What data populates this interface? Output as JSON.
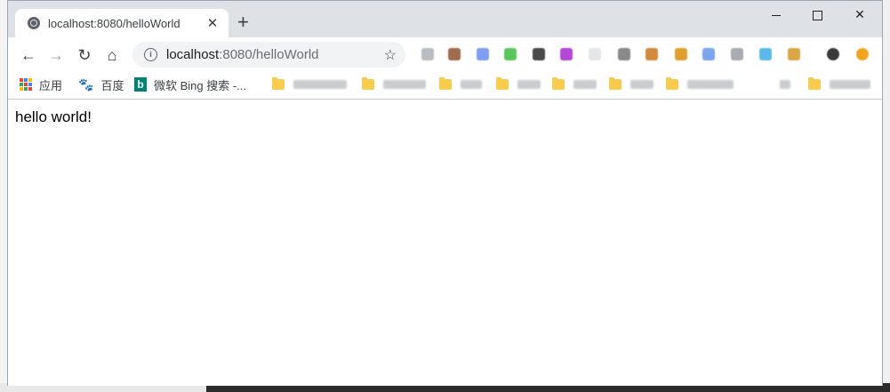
{
  "browser": {
    "tab": {
      "title": "localhost:8080/helloWorld",
      "close_glyph": "✕"
    },
    "new_tab_glyph": "+",
    "window_controls": {
      "close_glyph": "✕"
    },
    "toolbar": {
      "back_glyph": "←",
      "forward_glyph": "→",
      "reload_glyph": "↻",
      "home_glyph": "⌂",
      "star_glyph": "☆",
      "url_host": "localhost",
      "url_rest": ":8080/helloWorld"
    },
    "bookmarks": [
      {
        "label": "应用",
        "icon": "apps-grid-icon"
      },
      {
        "label": "百度",
        "icon": "baidu-paw-icon"
      },
      {
        "label": "微软 Bing 搜索 -...",
        "icon": "bing-icon"
      }
    ]
  },
  "page": {
    "body_text": "hello world!"
  },
  "colors": {
    "titlebar": "#dee1e6",
    "omnibox": "#f1f3f4",
    "bing": "#008373",
    "folder": "#f9cc4e"
  }
}
